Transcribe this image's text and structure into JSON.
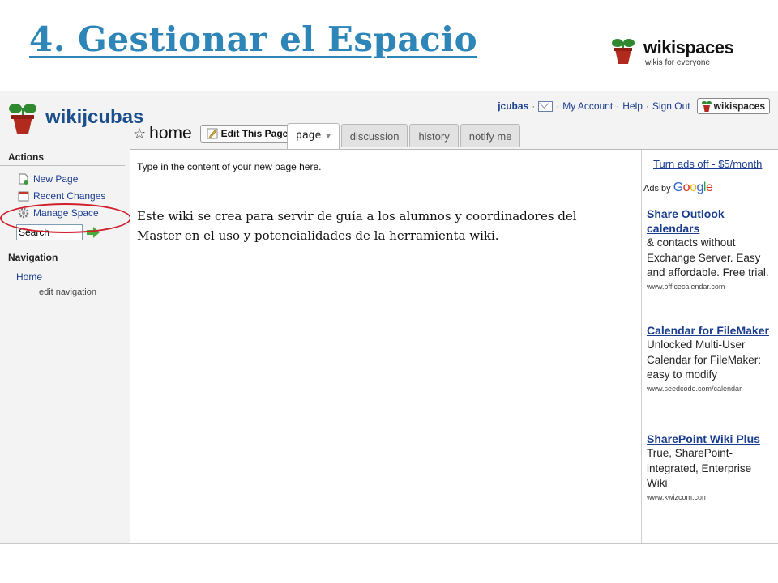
{
  "slide": {
    "title": "4. Gestionar el Espacio",
    "logo_brand": "wikispaces",
    "logo_tagline": "wikis for everyone"
  },
  "site": {
    "name": "wikijcubas",
    "user": "jcubas",
    "my_account": "My Account",
    "help": "Help",
    "sign_out": "Sign Out",
    "badge": "wikispaces"
  },
  "sidebar": {
    "actions_heading": "Actions",
    "actions": [
      {
        "label": "New Page",
        "icon": "new-page-icon"
      },
      {
        "label": "Recent Changes",
        "icon": "calendar-icon"
      },
      {
        "label": "Manage Space",
        "icon": "gear-icon"
      }
    ],
    "search_value": "Search",
    "navigation_heading": "Navigation",
    "nav_home": "Home",
    "edit_navigation": "edit navigation"
  },
  "page": {
    "name": "home",
    "edit_button": "Edit This Page",
    "tabs": [
      {
        "label": "page",
        "active": true
      },
      {
        "label": "discussion",
        "active": false
      },
      {
        "label": "history",
        "active": false
      },
      {
        "label": "notify me",
        "active": false
      }
    ],
    "intro": "Type in the content of your new page here.",
    "body_line1": "Este wiki se crea para servir de guía a los alumnos y coordinadores del",
    "body_line2": "Master en el uso y potencialidades de la herramienta wiki."
  },
  "ads": {
    "turn_off": "Turn ads off - $5/month",
    "ads_by": "Ads by",
    "provider": "Google",
    "items": [
      {
        "title1": "Share Outlook",
        "title2": "calendars",
        "desc": [
          "& contacts without",
          "Exchange Server. Easy",
          "and affordable. Free trial."
        ],
        "url": "www.officecalendar.com"
      },
      {
        "title1": "Calendar for FileMaker",
        "title2": "",
        "desc": [
          "Unlocked Multi-User",
          "Calendar for FileMaker:",
          "easy to modify"
        ],
        "url": "www.seedcode.com/calendar"
      },
      {
        "title1": "SharePoint Wiki Plus",
        "title2": "",
        "desc": [
          "True, SharePoint-",
          "integrated, Enterprise",
          "Wiki"
        ],
        "url": "www.kwizcom.com"
      }
    ]
  },
  "colors": {
    "title": "#2e86b8",
    "link": "#1a3d8f",
    "highlight": "#d21e2a"
  }
}
